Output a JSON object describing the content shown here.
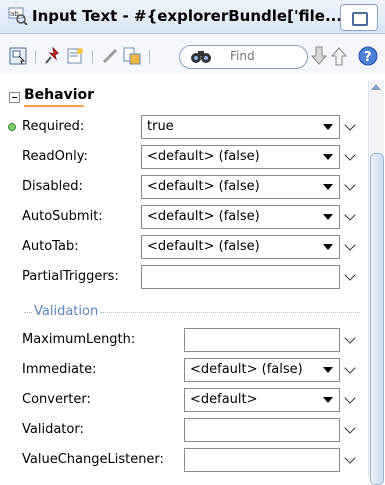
{
  "title_bar": {
    "title": "Input Text - #{explorerBundle['file..."
  },
  "toolbar": {
    "find_placeholder": "Find"
  },
  "section": {
    "title": "Behavior"
  },
  "properties": [
    {
      "label": "Required:",
      "type": "select",
      "value": "true",
      "required": true
    },
    {
      "label": "ReadOnly:",
      "type": "select",
      "value": "<default> (false)"
    },
    {
      "label": "Disabled:",
      "type": "select",
      "value": "<default> (false)"
    },
    {
      "label": "AutoSubmit:",
      "type": "select",
      "value": "<default> (false)"
    },
    {
      "label": "AutoTab:",
      "type": "select",
      "value": "<default> (false)"
    },
    {
      "label": "PartialTriggers:",
      "type": "text",
      "value": ""
    }
  ],
  "validation_group": {
    "title": "Validation",
    "properties": [
      {
        "label": "MaximumLength:",
        "type": "text",
        "value": ""
      },
      {
        "label": "Immediate:",
        "type": "select",
        "value": "<default> (false)"
      },
      {
        "label": "Converter:",
        "type": "select",
        "value": "<default>"
      },
      {
        "label": "Validator:",
        "type": "text",
        "value": ""
      },
      {
        "label": "ValueChangeListener:",
        "type": "text",
        "value": ""
      }
    ]
  },
  "colors": {
    "required_dot": "#7ccf6a",
    "group_title": "#5b86c4",
    "section_underline": "#f0a04a"
  }
}
